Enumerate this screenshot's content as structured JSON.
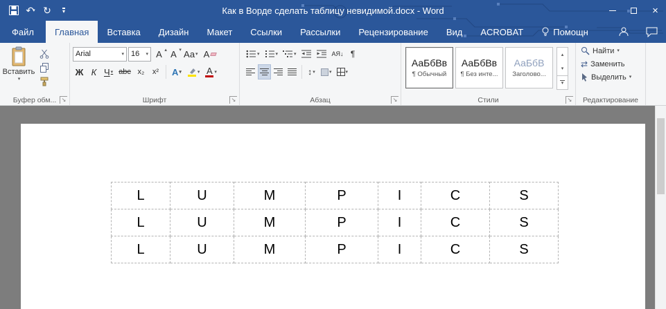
{
  "window": {
    "title": "Как в Ворде сделать таблицу невидимой.docx - Word"
  },
  "icon_glyphs": {
    "undo": "↶",
    "redo": "↻",
    "dropdown": "▾",
    "up_small": "▴",
    "down_small": "▾",
    "close": "×",
    "paragraph_mark": "¶",
    "sort": "АЯ↓",
    "line_spacing": "↕",
    "launcher": "↘",
    "replace_arrows": "⇄"
  },
  "tabs": {
    "file": "Файл",
    "items": [
      "Главная",
      "Вставка",
      "Дизайн",
      "Макет",
      "Ссылки",
      "Рассылки",
      "Рецензирование",
      "Вид",
      "ACROBAT",
      "Помощн"
    ]
  },
  "ribbon": {
    "clipboard": {
      "paste_label": "Вставить",
      "group_label": "Буфер обм..."
    },
    "font": {
      "name_value": "Arial",
      "size_value": "16",
      "grow": "А",
      "shrink": "А",
      "change_case": "Аа",
      "clear_format": "А",
      "bold": "Ж",
      "italic": "К",
      "underline": "Ч",
      "strikethrough": "abc",
      "subscript": "х₂",
      "superscript": "х²",
      "text_effects": "А",
      "font_color": "А",
      "group_label": "Шрифт"
    },
    "paragraph": {
      "group_label": "Абзац"
    },
    "styles": {
      "cards": [
        {
          "preview": "АаБбВв",
          "name": "¶ Обычный"
        },
        {
          "preview": "АаБбВв",
          "name": "¶ Без инте..."
        },
        {
          "preview": "АаБбВ",
          "name": "Заголово..."
        }
      ],
      "group_label": "Стили"
    },
    "editing": {
      "find": "Найти",
      "replace": "Заменить",
      "select": "Выделить",
      "group_label": "Редактирование"
    }
  },
  "document": {
    "table_rows": [
      [
        "L",
        "U",
        "M",
        "P",
        "I",
        "C",
        "S"
      ],
      [
        "L",
        "U",
        "M",
        "P",
        "I",
        "C",
        "S"
      ],
      [
        "L",
        "U",
        "M",
        "P",
        "I",
        "C",
        "S"
      ]
    ]
  },
  "colors": {
    "accent": "#2b579a",
    "ribbon_bg": "#f5f6f7",
    "doc_bg": "#7d7d7d",
    "table_border": "#b3b3b3",
    "font_color_red": "#c00000",
    "highlight_yellow": "#fce300"
  }
}
